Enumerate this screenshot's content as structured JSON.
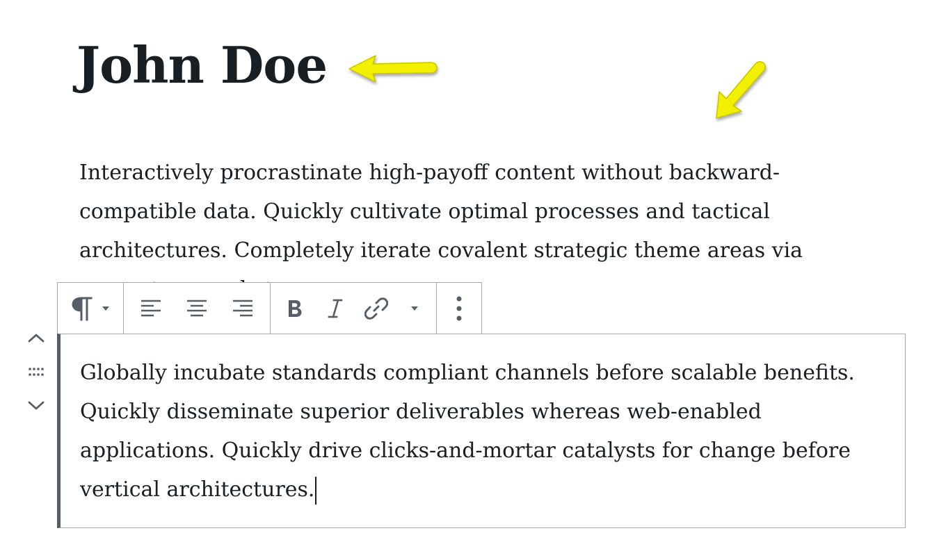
{
  "post": {
    "title": "John Doe",
    "paragraph_1": {
      "lines": [
        "Interactively procrastinate high-payoff content without backward-",
        "compatible data. Quickly cultivate optimal processes and tactical",
        "architectures. Completely iterate covalent strategic theme areas via",
        "accurate e-markets."
      ]
    },
    "paragraph_2": {
      "lines": [
        "Globally incubate standards compliant channels before scalable benefits.",
        "Quickly disseminate superior deliverables whereas web-enabled",
        "applications. Quickly drive clicks-and-mortar catalysts for change before",
        "vertical architectures."
      ]
    }
  },
  "toolbar": {
    "block_type_icon": "paragraph-icon",
    "groups": [
      [
        "paragraph-icon",
        "dropdown-caret-icon"
      ],
      [
        "align-left-icon",
        "align-center-icon",
        "align-right-icon"
      ],
      [
        "bold-icon",
        "italic-icon",
        "link-icon",
        "more-formatting-caret-icon"
      ],
      [
        "more-options-icon"
      ]
    ]
  },
  "block_movers": [
    "move-up-icon",
    "drag-handle-icon",
    "move-down-icon"
  ],
  "colors": {
    "text": "#191e23",
    "icon": "#555d66",
    "border": "#a2aab2",
    "annotation_arrow": "#f2f000"
  }
}
